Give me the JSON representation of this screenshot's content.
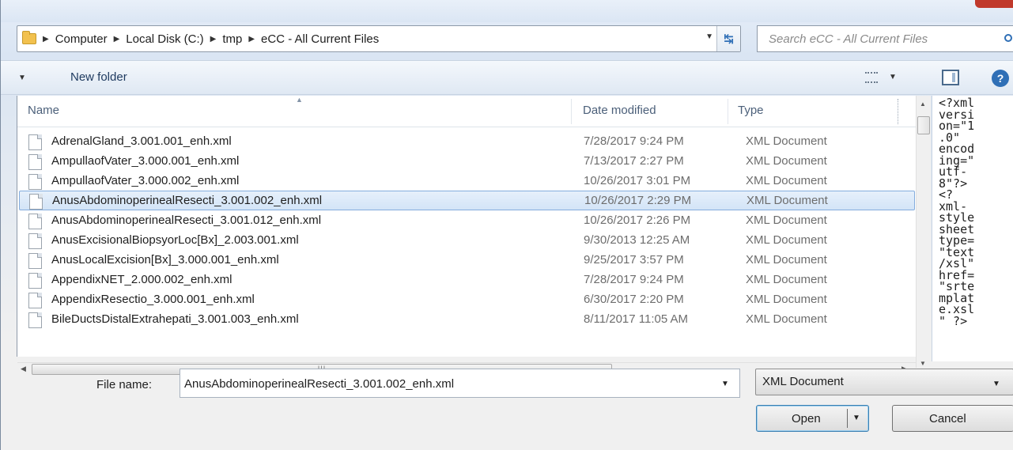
{
  "address": {
    "crumbs": [
      "Computer",
      "Local Disk (C:)",
      "tmp",
      "eCC - All Current Files"
    ]
  },
  "search": {
    "placeholder": "Search eCC - All Current Files"
  },
  "toolbar": {
    "new_folder": "New folder"
  },
  "columns": {
    "name": "Name",
    "date": "Date modified",
    "type": "Type"
  },
  "files": [
    {
      "name": "AdrenalGland_3.001.001_enh.xml",
      "date": "7/28/2017 9:24 PM",
      "type": "XML Document",
      "selected": false
    },
    {
      "name": "AmpullaofVater_3.000.001_enh.xml",
      "date": "7/13/2017 2:27 PM",
      "type": "XML Document",
      "selected": false
    },
    {
      "name": "AmpullaofVater_3.000.002_enh.xml",
      "date": "10/26/2017 3:01 PM",
      "type": "XML Document",
      "selected": false
    },
    {
      "name": "AnusAbdominoperinealResecti_3.001.002_enh.xml",
      "date": "10/26/2017 2:29 PM",
      "type": "XML Document",
      "selected": true
    },
    {
      "name": "AnusAbdominoperinealResecti_3.001.012_enh.xml",
      "date": "10/26/2017 2:26 PM",
      "type": "XML Document",
      "selected": false
    },
    {
      "name": "AnusExcisionalBiopsyorLoc[Bx]_2.003.001.xml",
      "date": "9/30/2013 12:25 AM",
      "type": "XML Document",
      "selected": false
    },
    {
      "name": "AnusLocalExcision[Bx]_3.000.001_enh.xml",
      "date": "9/25/2017 3:57 PM",
      "type": "XML Document",
      "selected": false
    },
    {
      "name": "AppendixNET_2.000.002_enh.xml",
      "date": "7/28/2017 9:24 PM",
      "type": "XML Document",
      "selected": false
    },
    {
      "name": "AppendixResectio_3.000.001_enh.xml",
      "date": "6/30/2017 2:20 PM",
      "type": "XML Document",
      "selected": false
    },
    {
      "name": "BileDuctsDistalExtrahepati_3.001.003_enh.xml",
      "date": "8/11/2017 11:05 AM",
      "type": "XML Document",
      "selected": false
    }
  ],
  "preview_text": "<?xml\nversi\non=\"1\n.0\"\nencod\ning=\"\nutf-\n8\"?>\n<?\nxml-\nstyle\nsheet\ntype=\n\"text\n/xsl\"\nhref=\n\"srte\nmplat\ne.xsl\n\" ?>",
  "filename": {
    "label": "File name:",
    "value": "AnusAbdominoperinealResecti_3.001.002_enh.xml"
  },
  "filetype": {
    "value": "XML Document"
  },
  "buttons": {
    "open": "Open",
    "cancel": "Cancel"
  },
  "hscroll_grip": "III"
}
